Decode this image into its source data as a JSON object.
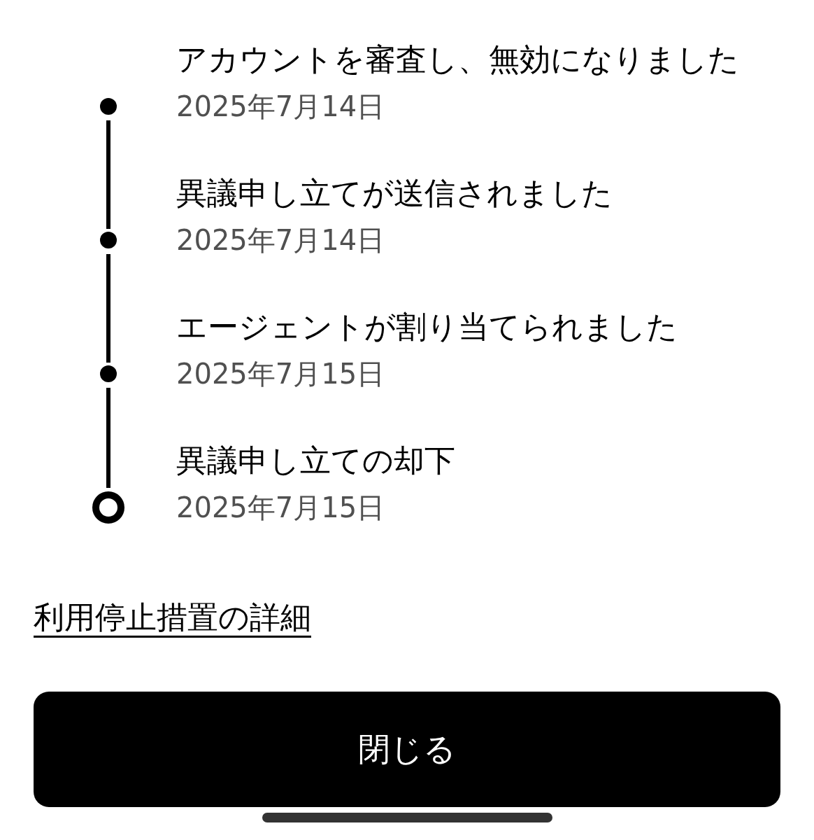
{
  "timeline": [
    {
      "title": "アカウントを審査し、無効になりました",
      "date": "2025年7月14日",
      "kind": "dot"
    },
    {
      "title": "異議申し立てが送信されました",
      "date": "2025年7月14日",
      "kind": "dot"
    },
    {
      "title": "エージェントが割り当てられました",
      "date": "2025年7月15日",
      "kind": "dot"
    },
    {
      "title": "異議申し立ての却下",
      "date": "2025年7月15日",
      "kind": "ring"
    }
  ],
  "details_link": {
    "label": "利用停止措置の詳細"
  },
  "close_button": {
    "label": "閉じる"
  }
}
